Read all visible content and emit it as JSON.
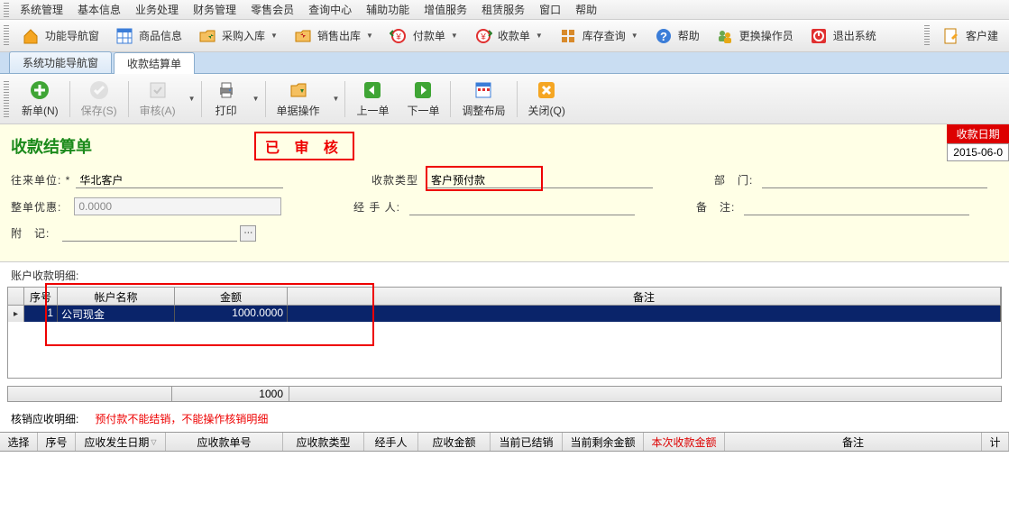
{
  "menu": {
    "items": [
      "系统管理",
      "基本信息",
      "业务处理",
      "财务管理",
      "零售会员",
      "查询中心",
      "辅助功能",
      "增值服务",
      "租赁服务",
      "窗口",
      "帮助"
    ]
  },
  "mainToolbar": {
    "items": [
      {
        "label": "功能导航窗",
        "icon": "home",
        "color": "#F5A623"
      },
      {
        "label": "商品信息",
        "icon": "grid",
        "color": "#3B7DD8"
      },
      {
        "label": "采购入库",
        "icon": "folder-in",
        "color": "#E6A817"
      },
      {
        "label": "销售出库",
        "icon": "folder-out",
        "color": "#E6A817"
      },
      {
        "label": "付款单",
        "icon": "pay",
        "color": "#E03030"
      },
      {
        "label": "收款单",
        "icon": "receive",
        "color": "#E03030"
      },
      {
        "label": "库存查询",
        "icon": "stock",
        "color": "#D88A2A"
      },
      {
        "label": "帮助",
        "icon": "help",
        "color": "#3B7DD8"
      },
      {
        "label": "更换操作员",
        "icon": "users",
        "color": "#6AA84F"
      },
      {
        "label": "退出系统",
        "icon": "exit",
        "color": "#E03030"
      }
    ],
    "right": {
      "label": "客户建",
      "icon": "note",
      "color": "#F5A623"
    }
  },
  "tabs": [
    {
      "label": "系统功能导航窗",
      "active": false
    },
    {
      "label": "收款结算单",
      "active": true
    }
  ],
  "actionToolbar": [
    {
      "label": "新单(N)",
      "icon": "plus",
      "color": "#3FA535",
      "disabled": false
    },
    {
      "label": "保存(S)",
      "icon": "check",
      "color": "#999",
      "disabled": true
    },
    {
      "label": "审核(A)",
      "icon": "audit",
      "color": "#999",
      "disabled": true
    },
    {
      "label": "打印",
      "icon": "print",
      "color": "#3B7DD8",
      "disabled": false,
      "dropdown": true
    },
    {
      "label": "单据操作",
      "icon": "doc-op",
      "color": "#E6A817",
      "disabled": false,
      "dropdown": true
    },
    {
      "label": "上一单",
      "icon": "prev",
      "color": "#3FA535",
      "disabled": false
    },
    {
      "label": "下一单",
      "icon": "next",
      "color": "#3FA535",
      "disabled": false
    },
    {
      "label": "调整布局",
      "icon": "layout",
      "color": "#3B7DD8",
      "disabled": false
    },
    {
      "label": "关闭(Q)",
      "icon": "close",
      "color": "#F5A623",
      "disabled": false
    }
  ],
  "form": {
    "title": "收款结算单",
    "auditStamp": "已 审 核",
    "dateLabel": "收款日期",
    "dateValue": "2015-06-0",
    "fields": {
      "unit": {
        "label": "往来单位: *",
        "value": "华北客户"
      },
      "type": {
        "label": "收款类型",
        "value": "客户预付款"
      },
      "dept": {
        "label": "部　门:",
        "value": ""
      },
      "discount": {
        "label": "整单优惠:",
        "value": "0.0000"
      },
      "handler": {
        "label": "经 手 人:",
        "value": ""
      },
      "remark": {
        "label": "备　注:",
        "value": ""
      },
      "attach": {
        "label": "附　记:",
        "value": ""
      }
    }
  },
  "detail": {
    "label": "账户收款明细:",
    "headers": [
      "序号",
      "帐户名称",
      "金额",
      "备注"
    ],
    "rows": [
      {
        "seq": "1",
        "account": "公司现金",
        "amount": "1000.0000",
        "remark": ""
      }
    ],
    "total": "1000"
  },
  "writeoff": {
    "label": "核销应收明细:",
    "message": "预付款不能结销，不能操作核销明细",
    "headers": [
      "选择",
      "序号",
      "应收发生日期",
      "应收款单号",
      "应收款类型",
      "经手人",
      "应收金额",
      "当前已结销",
      "当前剩余金额",
      "本次收款金额",
      "备注",
      "计"
    ]
  }
}
